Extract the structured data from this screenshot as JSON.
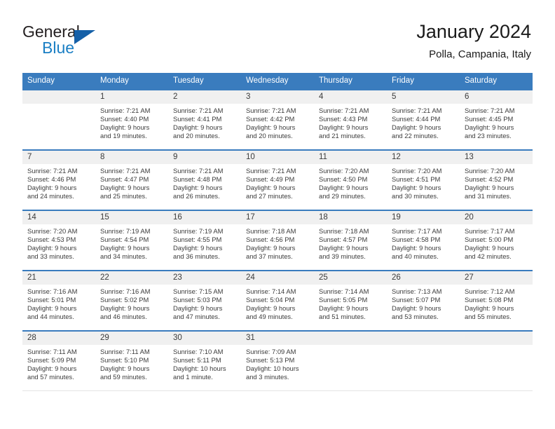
{
  "brand": {
    "name_part1": "General",
    "name_part2": "Blue",
    "logo_icon": "triangle-flag-icon"
  },
  "header": {
    "title": "January 2024",
    "subtitle": "Polla, Campania, Italy"
  },
  "calendar": {
    "weekday_headers": [
      "Sunday",
      "Monday",
      "Tuesday",
      "Wednesday",
      "Thursday",
      "Friday",
      "Saturday"
    ],
    "accent_color": "#3a7cbe",
    "daynum_band_color": "#f0f0f0",
    "weeks": [
      [
        {
          "day": "",
          "lines": []
        },
        {
          "day": "1",
          "lines": [
            "Sunrise: 7:21 AM",
            "Sunset: 4:40 PM",
            "Daylight: 9 hours",
            "and 19 minutes."
          ]
        },
        {
          "day": "2",
          "lines": [
            "Sunrise: 7:21 AM",
            "Sunset: 4:41 PM",
            "Daylight: 9 hours",
            "and 20 minutes."
          ]
        },
        {
          "day": "3",
          "lines": [
            "Sunrise: 7:21 AM",
            "Sunset: 4:42 PM",
            "Daylight: 9 hours",
            "and 20 minutes."
          ]
        },
        {
          "day": "4",
          "lines": [
            "Sunrise: 7:21 AM",
            "Sunset: 4:43 PM",
            "Daylight: 9 hours",
            "and 21 minutes."
          ]
        },
        {
          "day": "5",
          "lines": [
            "Sunrise: 7:21 AM",
            "Sunset: 4:44 PM",
            "Daylight: 9 hours",
            "and 22 minutes."
          ]
        },
        {
          "day": "6",
          "lines": [
            "Sunrise: 7:21 AM",
            "Sunset: 4:45 PM",
            "Daylight: 9 hours",
            "and 23 minutes."
          ]
        }
      ],
      [
        {
          "day": "7",
          "lines": [
            "Sunrise: 7:21 AM",
            "Sunset: 4:46 PM",
            "Daylight: 9 hours",
            "and 24 minutes."
          ]
        },
        {
          "day": "8",
          "lines": [
            "Sunrise: 7:21 AM",
            "Sunset: 4:47 PM",
            "Daylight: 9 hours",
            "and 25 minutes."
          ]
        },
        {
          "day": "9",
          "lines": [
            "Sunrise: 7:21 AM",
            "Sunset: 4:48 PM",
            "Daylight: 9 hours",
            "and 26 minutes."
          ]
        },
        {
          "day": "10",
          "lines": [
            "Sunrise: 7:21 AM",
            "Sunset: 4:49 PM",
            "Daylight: 9 hours",
            "and 27 minutes."
          ]
        },
        {
          "day": "11",
          "lines": [
            "Sunrise: 7:20 AM",
            "Sunset: 4:50 PM",
            "Daylight: 9 hours",
            "and 29 minutes."
          ]
        },
        {
          "day": "12",
          "lines": [
            "Sunrise: 7:20 AM",
            "Sunset: 4:51 PM",
            "Daylight: 9 hours",
            "and 30 minutes."
          ]
        },
        {
          "day": "13",
          "lines": [
            "Sunrise: 7:20 AM",
            "Sunset: 4:52 PM",
            "Daylight: 9 hours",
            "and 31 minutes."
          ]
        }
      ],
      [
        {
          "day": "14",
          "lines": [
            "Sunrise: 7:20 AM",
            "Sunset: 4:53 PM",
            "Daylight: 9 hours",
            "and 33 minutes."
          ]
        },
        {
          "day": "15",
          "lines": [
            "Sunrise: 7:19 AM",
            "Sunset: 4:54 PM",
            "Daylight: 9 hours",
            "and 34 minutes."
          ]
        },
        {
          "day": "16",
          "lines": [
            "Sunrise: 7:19 AM",
            "Sunset: 4:55 PM",
            "Daylight: 9 hours",
            "and 36 minutes."
          ]
        },
        {
          "day": "17",
          "lines": [
            "Sunrise: 7:18 AM",
            "Sunset: 4:56 PM",
            "Daylight: 9 hours",
            "and 37 minutes."
          ]
        },
        {
          "day": "18",
          "lines": [
            "Sunrise: 7:18 AM",
            "Sunset: 4:57 PM",
            "Daylight: 9 hours",
            "and 39 minutes."
          ]
        },
        {
          "day": "19",
          "lines": [
            "Sunrise: 7:17 AM",
            "Sunset: 4:58 PM",
            "Daylight: 9 hours",
            "and 40 minutes."
          ]
        },
        {
          "day": "20",
          "lines": [
            "Sunrise: 7:17 AM",
            "Sunset: 5:00 PM",
            "Daylight: 9 hours",
            "and 42 minutes."
          ]
        }
      ],
      [
        {
          "day": "21",
          "lines": [
            "Sunrise: 7:16 AM",
            "Sunset: 5:01 PM",
            "Daylight: 9 hours",
            "and 44 minutes."
          ]
        },
        {
          "day": "22",
          "lines": [
            "Sunrise: 7:16 AM",
            "Sunset: 5:02 PM",
            "Daylight: 9 hours",
            "and 46 minutes."
          ]
        },
        {
          "day": "23",
          "lines": [
            "Sunrise: 7:15 AM",
            "Sunset: 5:03 PM",
            "Daylight: 9 hours",
            "and 47 minutes."
          ]
        },
        {
          "day": "24",
          "lines": [
            "Sunrise: 7:14 AM",
            "Sunset: 5:04 PM",
            "Daylight: 9 hours",
            "and 49 minutes."
          ]
        },
        {
          "day": "25",
          "lines": [
            "Sunrise: 7:14 AM",
            "Sunset: 5:05 PM",
            "Daylight: 9 hours",
            "and 51 minutes."
          ]
        },
        {
          "day": "26",
          "lines": [
            "Sunrise: 7:13 AM",
            "Sunset: 5:07 PM",
            "Daylight: 9 hours",
            "and 53 minutes."
          ]
        },
        {
          "day": "27",
          "lines": [
            "Sunrise: 7:12 AM",
            "Sunset: 5:08 PM",
            "Daylight: 9 hours",
            "and 55 minutes."
          ]
        }
      ],
      [
        {
          "day": "28",
          "lines": [
            "Sunrise: 7:11 AM",
            "Sunset: 5:09 PM",
            "Daylight: 9 hours",
            "and 57 minutes."
          ]
        },
        {
          "day": "29",
          "lines": [
            "Sunrise: 7:11 AM",
            "Sunset: 5:10 PM",
            "Daylight: 9 hours",
            "and 59 minutes."
          ]
        },
        {
          "day": "30",
          "lines": [
            "Sunrise: 7:10 AM",
            "Sunset: 5:11 PM",
            "Daylight: 10 hours",
            "and 1 minute."
          ]
        },
        {
          "day": "31",
          "lines": [
            "Sunrise: 7:09 AM",
            "Sunset: 5:13 PM",
            "Daylight: 10 hours",
            "and 3 minutes."
          ]
        },
        {
          "day": "",
          "lines": []
        },
        {
          "day": "",
          "lines": []
        },
        {
          "day": "",
          "lines": []
        }
      ]
    ]
  }
}
